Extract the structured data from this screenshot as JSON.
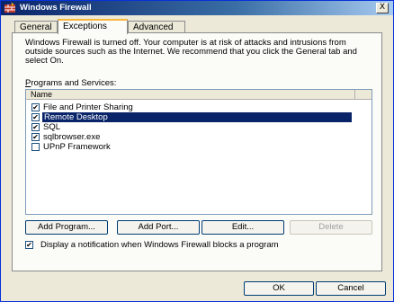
{
  "window": {
    "title": "Windows Firewall",
    "close_label": "X"
  },
  "tabs": [
    {
      "label": "General",
      "active": false
    },
    {
      "label": "Exceptions",
      "active": true
    },
    {
      "label": "Advanced",
      "active": false
    }
  ],
  "notice": "Windows Firewall is turned off. Your computer is at risk of attacks and intrusions from outside sources such as the Internet. We recommend that you click the General tab and select On.",
  "programs": {
    "label_accel": "P",
    "label_rest": "rograms and Services:",
    "column_header": "Name",
    "items": [
      {
        "label": "File and Printer Sharing",
        "checked": true,
        "selected": false
      },
      {
        "label": "Remote Desktop",
        "checked": true,
        "selected": true
      },
      {
        "label": "SQL",
        "checked": true,
        "selected": false
      },
      {
        "label": "sqlbrowser.exe",
        "checked": true,
        "selected": false
      },
      {
        "label": "UPnP Framework",
        "checked": false,
        "selected": false
      }
    ]
  },
  "buttons": {
    "add_program": "Add Program...",
    "add_port": "Add Port...",
    "edit": "Edit...",
    "delete": "Delete"
  },
  "notify": {
    "checked": true,
    "label": "Display a notification when Windows Firewall blocks a program"
  },
  "footer": {
    "ok": "OK",
    "cancel": "Cancel"
  },
  "colors": {
    "selection": "#0a246a",
    "titlebar": "#0a246a"
  }
}
